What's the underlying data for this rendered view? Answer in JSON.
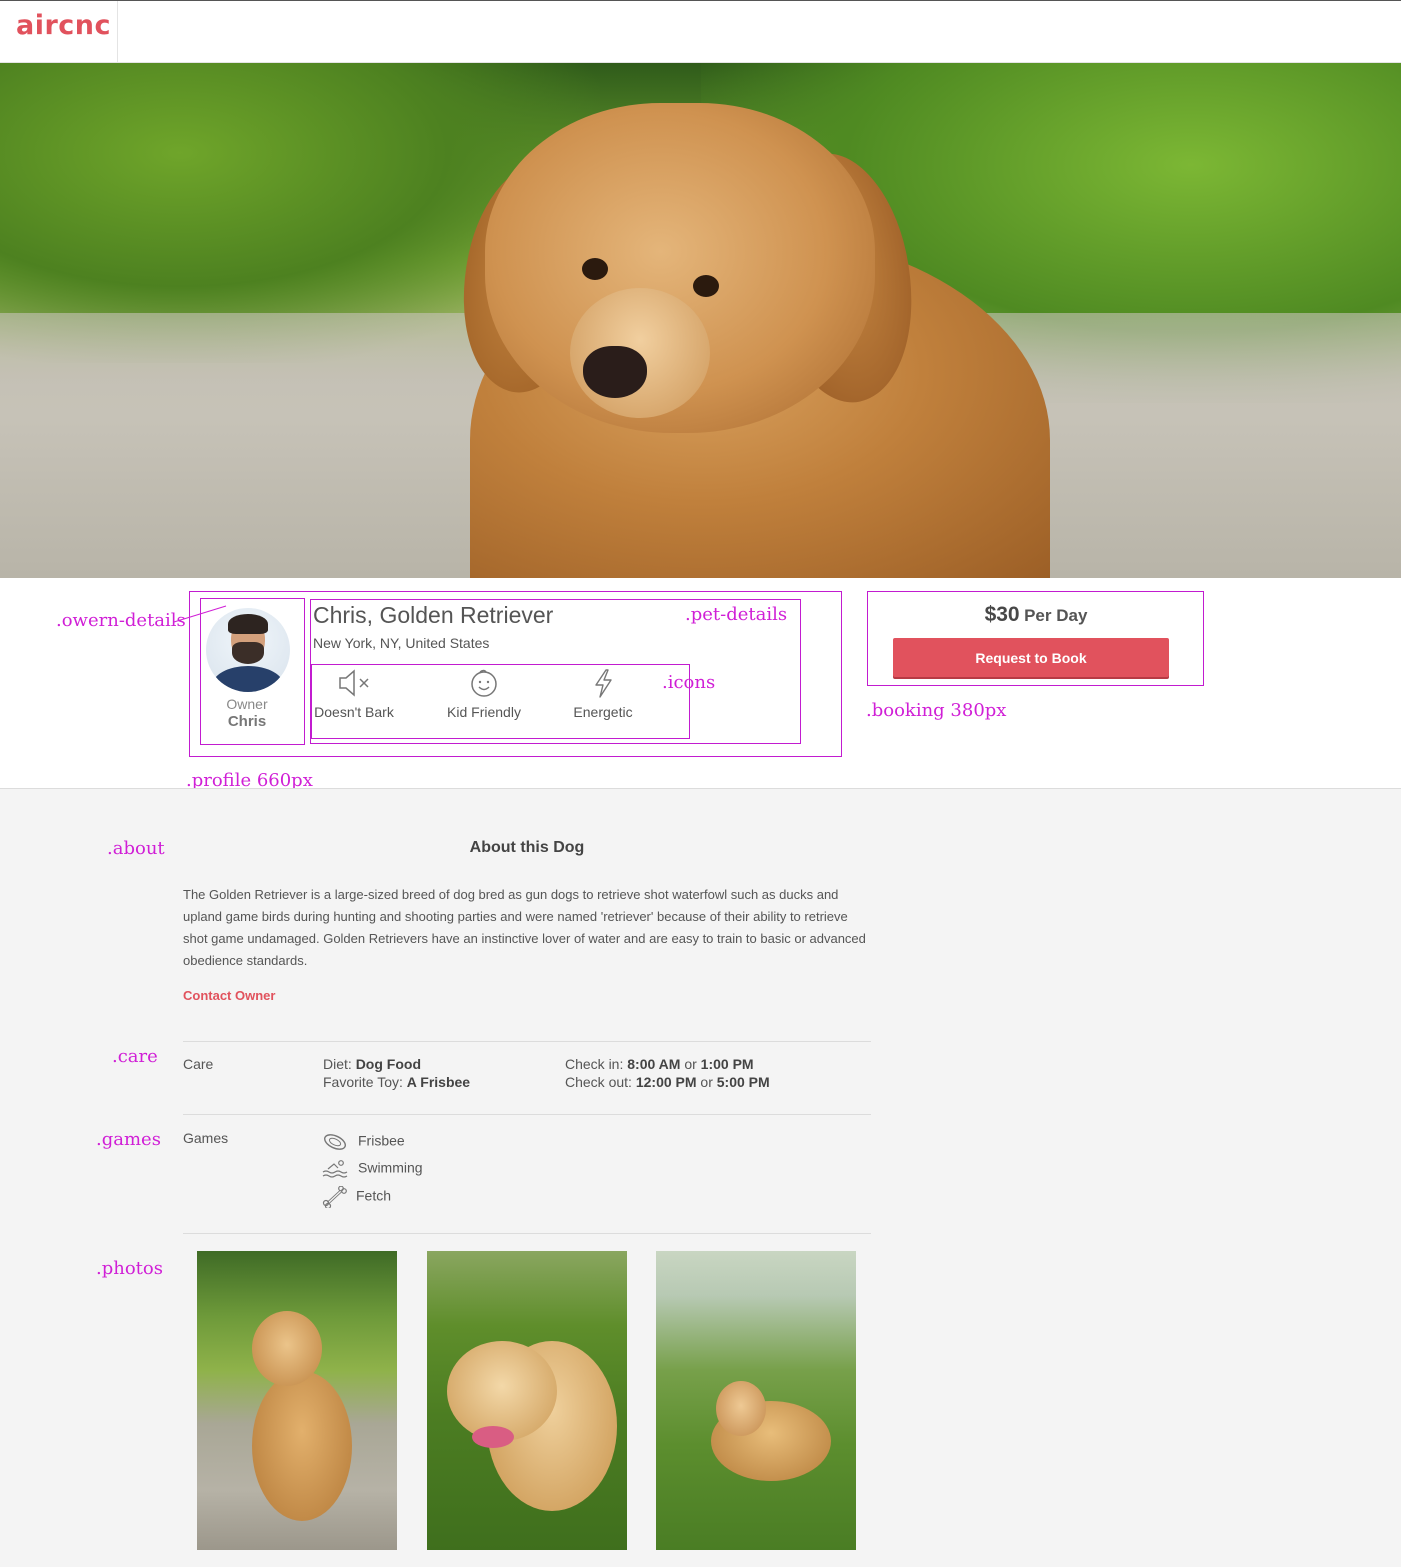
{
  "brand": {
    "logo": "aircnc",
    "accent": "#e1525d"
  },
  "annotations": {
    "owner_details": ".owern-details",
    "pet_details": ".pet-details",
    "icons": ".icons",
    "booking": ".booking 380px",
    "profile": ".profile 660px",
    "about": ".about",
    "care": ".care",
    "games": ".games",
    "photos": ".photos",
    "annotation_color": "#d01fd6"
  },
  "owner": {
    "label": "Owner",
    "name": "Chris"
  },
  "pet": {
    "title": "Chris, Golden Retriever",
    "location": "New York, NY, United States",
    "traits": [
      {
        "icon": "mute-speaker-icon",
        "label": "Doesn't Bark"
      },
      {
        "icon": "baby-face-icon",
        "label": "Kid Friendly"
      },
      {
        "icon": "lightning-bolt-icon",
        "label": "Energetic"
      }
    ]
  },
  "booking": {
    "price": "$30",
    "unit": "Per Day",
    "button": "Request to Book"
  },
  "about": {
    "title": "About this Dog",
    "text": "The Golden Retriever is a large-sized breed of dog bred as gun dogs to retrieve shot waterfowl such as ducks and upland game birds during hunting and shooting parties and were named 'retriever' because of their ability to retrieve shot game undamaged. Golden Retrievers have an instinctive lover of water and are easy to train to basic or advanced obedience standards.",
    "contact": "Contact Owner"
  },
  "care": {
    "label": "Care",
    "diet_label": "Diet:",
    "diet_value": "Dog Food",
    "toy_label": "Favorite Toy:",
    "toy_value": "A Frisbee",
    "checkin_label": "Check in:",
    "checkin_a": "8:00 AM",
    "checkin_or": "or",
    "checkin_b": "1:00 PM",
    "checkout_label": "Check out:",
    "checkout_a": "12:00 PM",
    "checkout_or": "or",
    "checkout_b": "5:00 PM"
  },
  "games": {
    "label": "Games",
    "items": [
      {
        "icon": "frisbee-icon",
        "label": "Frisbee"
      },
      {
        "icon": "swimming-icon",
        "label": "Swimming"
      },
      {
        "icon": "bone-icon",
        "label": "Fetch"
      }
    ]
  },
  "photos": [
    {
      "name": "dog-photo-sitting"
    },
    {
      "name": "dog-photo-panting"
    },
    {
      "name": "dog-photo-lying"
    }
  ]
}
